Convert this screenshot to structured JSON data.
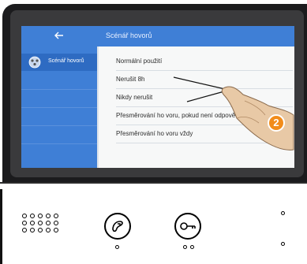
{
  "screen": {
    "header": {
      "back_icon": "left-arrow-icon",
      "title": "Scénář hovorů"
    },
    "sidebar": {
      "item_label": "Scénář hovorů",
      "item_icon": "call-scenario-icon"
    },
    "options": [
      "Normální použití",
      "Nerušit 8h",
      "Nikdy nerušit",
      "Přesměrování ho voru, pokud není odpově d",
      "Přesměrování ho voru vždy"
    ],
    "callout_badge": "2"
  },
  "colors": {
    "accent": "#3f7fd6",
    "content_bg": "#f7f8f8",
    "badge": "#f28c1a",
    "bezel": "#1b1b1d"
  },
  "hardware": {
    "left_button_icon": "intercom-call-icon",
    "right_button_icon": "key-unlock-icon"
  }
}
